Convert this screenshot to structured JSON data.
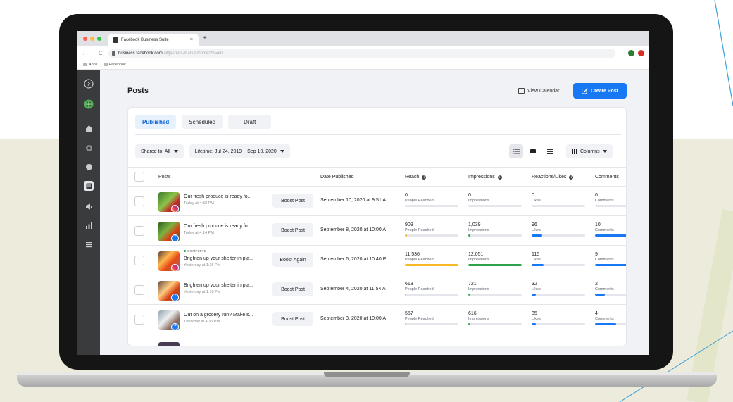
{
  "browser": {
    "tab_title": "Facebook Business Suite",
    "tab_close": "×",
    "new_tab": "+",
    "url_host": "business.facebook.com",
    "url_path": "/all/jaspers-market/home/?hl=en",
    "bookmarks": [
      "Apps",
      "Facebook"
    ]
  },
  "header": {
    "title": "Posts",
    "view_calendar": "View Calendar",
    "create_post": "Create Post"
  },
  "tabs": [
    "Published",
    "Scheduled",
    "Draft"
  ],
  "filters": {
    "shared_to": "Shared to: All",
    "lifetime": "Lifetime: Jul 24, 2019 ~ Sep 10, 2020",
    "columns": "Columns"
  },
  "columns": {
    "posts": "Posts",
    "date": "Date Published",
    "reach": "Reach",
    "impressions": "Impressions",
    "reactions": "Reactions/Likes",
    "comments": "Comments"
  },
  "labels": {
    "reach": "People Reached",
    "impressions": "Impressions",
    "likes": "Likes",
    "comments": "Comments",
    "complete": "COMPLETE"
  },
  "colors": {
    "accent": "#1877f2",
    "reach_bar": "#f7b928",
    "impressions_bar": "#31a24c",
    "likes_bar": "#1877f2",
    "comments_bar": "#1877f2"
  },
  "rows": [
    {
      "title": "Our fresh produce is ready fo...",
      "time": "Today at 4:32 PM",
      "platform": "instagram",
      "complete": false,
      "action": "Boost Post",
      "date": "September 10, 2020 at 9:51 A",
      "reach": "0",
      "reach_pct": 0,
      "impressions": "0",
      "impressions_pct": 0,
      "likes": "0",
      "likes_pct": 0,
      "comments": "0",
      "comments_pct": 0
    },
    {
      "title": "Our fresh produce is ready fo...",
      "time": "Today at 4:14 PM",
      "platform": "facebook",
      "complete": false,
      "action": "Boost Post",
      "date": "September 8, 2020 at 10:00 A",
      "reach": "909",
      "reach_pct": 4,
      "impressions": "1,039",
      "impressions_pct": 4,
      "likes": "96",
      "likes_pct": 20,
      "comments": "10",
      "comments_pct": 100
    },
    {
      "title": "Brighten up your shelter in pla...",
      "time": "Yesterday at 1:26 PM",
      "platform": "instagram",
      "complete": true,
      "action": "Boost Again",
      "date": "September 6, 2020 at 10:40 P",
      "reach": "11,536",
      "reach_pct": 100,
      "impressions": "12,051",
      "impressions_pct": 100,
      "likes": "115",
      "likes_pct": 22,
      "comments": "9",
      "comments_pct": 92
    },
    {
      "title": "Brighten up your shelter in pla...",
      "time": "Yesterday at 1:18 PM",
      "platform": "facebook",
      "complete": false,
      "action": "Boost Post",
      "date": "September 4, 2020 at 11:54 A",
      "reach": "613",
      "reach_pct": 3,
      "impressions": "721",
      "impressions_pct": 3,
      "likes": "32",
      "likes_pct": 8,
      "comments": "2",
      "comments_pct": 18
    },
    {
      "title": "Out on a grocery run? Make s...",
      "time": "Thursday at 4:36 PM",
      "platform": "facebook",
      "complete": false,
      "action": "Boost Post",
      "date": "September 3, 2020 at 10:00 A",
      "reach": "557",
      "reach_pct": 3,
      "impressions": "616",
      "impressions_pct": 3,
      "likes": "35",
      "likes_pct": 8,
      "comments": "4",
      "comments_pct": 40
    }
  ]
}
